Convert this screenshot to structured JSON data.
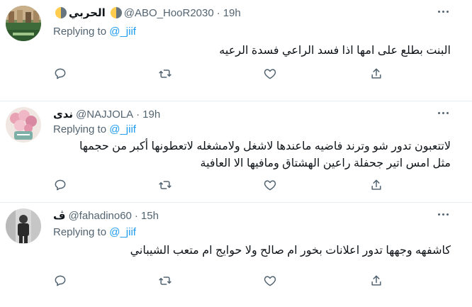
{
  "tweets": [
    {
      "name": "الحربي",
      "handle": "@ABO_HooR2030",
      "dot": "·",
      "time": "19h",
      "replying_label": "Replying to",
      "replying_to": "@_jiif",
      "lines": [
        "البنت بطلع على امها اذا فسد الراعي فسدة الرعيه"
      ]
    },
    {
      "name": "ندى",
      "handle": "@NAJJOLA",
      "dot": "·",
      "time": "19h",
      "replying_label": "Replying to",
      "replying_to": "@_jiif",
      "lines": [
        "لاتتعبون تدور شو وترند فاضيه ماعندها لاشغل ولامشغله لاتعطونها أكبر من حجمها",
        "مثل امس اتير جحفلة راعين الهشتاق ومافيها الا العافية"
      ]
    },
    {
      "name": "ڤ",
      "handle": "@fahadino60",
      "dot": "·",
      "time": "15h",
      "replying_label": "Replying to",
      "replying_to": "@_jiif",
      "lines": [
        "كاشفهه وجهها تدور اعلانات بخور ام صالح ولا حوايج ام متعب الشيباني"
      ]
    }
  ],
  "icons": {
    "more": "more-icon",
    "reply": "reply-icon",
    "retweet": "retweet-icon",
    "like": "like-icon",
    "share": "share-icon"
  }
}
